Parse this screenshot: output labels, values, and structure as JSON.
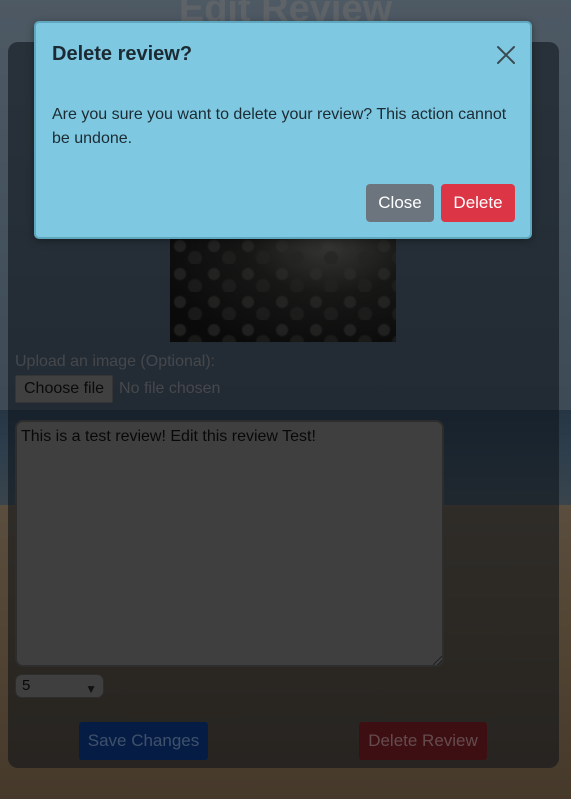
{
  "page": {
    "title": "Edit Review"
  },
  "form": {
    "upload_label": "Upload an image (Optional):",
    "choose_file_label": "Choose file",
    "no_file_text": "No file chosen",
    "review_text": "This is a test review! Edit this review Test!",
    "rating_value": "5",
    "save_label": "Save Changes",
    "delete_review_label": "Delete Review"
  },
  "modal": {
    "title": "Delete review?",
    "body": "Are you sure you want to delete your review? This action cannot be undone.",
    "close_label": "Close",
    "delete_label": "Delete"
  },
  "colors": {
    "modal_bg": "#7ec8e1",
    "close_button": "#6c757d",
    "delete_button": "#dc3545",
    "save_button": "#0a3a8a",
    "delete_review_button": "#7a1f27"
  },
  "icons": {
    "modal_close": "close-icon",
    "select_chevron": "chevron-down-icon",
    "resize_handle": "resize-grip-icon"
  }
}
